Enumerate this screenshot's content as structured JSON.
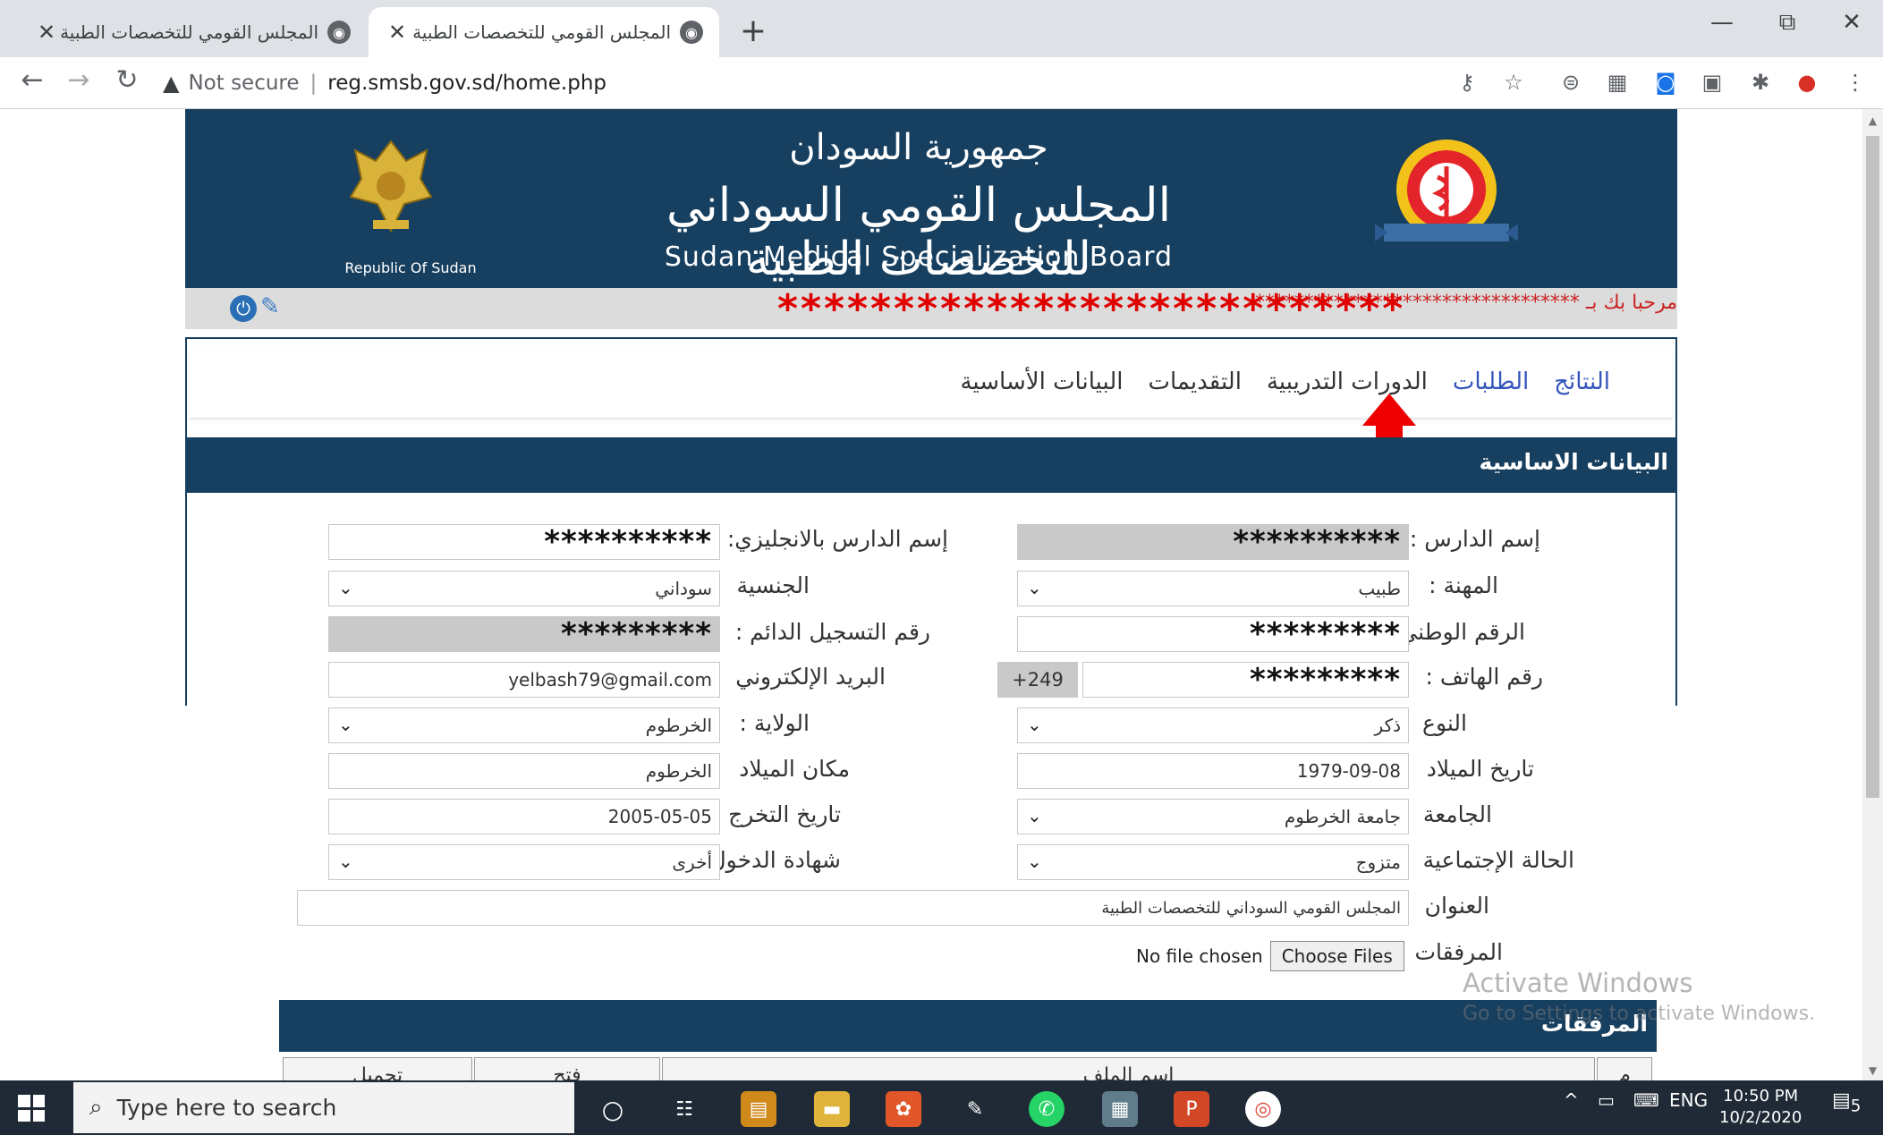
{
  "browser": {
    "tabs": [
      {
        "title": "المجلس القومي للتخصصات الطبية",
        "active": false
      },
      {
        "title": "المجلس القومي للتخصصات الطبية",
        "active": true
      }
    ],
    "new_tab": "+",
    "security": "Not secure",
    "url": "reg.smsb.gov.sd/home.php",
    "window_controls": {
      "minimize": "—",
      "restore": "⧉",
      "close": "✕"
    }
  },
  "banner": {
    "republic_label": "Republic Of Sudan",
    "arabic_line1": "جمهورية السودان",
    "arabic_line2": "المجلس القومي السوداني للتخصصات الطبية",
    "english_title": "Sudan Medical Specialization Board",
    "bg_color": "#173f5f"
  },
  "welcome": {
    "text": "مرحبا بك بـ *********************************",
    "stars": "***************************"
  },
  "menu": {
    "items": [
      {
        "label": "البيانات الأساسية",
        "style": "dark"
      },
      {
        "label": "التقديمات",
        "style": "dark"
      },
      {
        "label": "الدورات التدريبية",
        "style": "dark"
      },
      {
        "label": "الطلبات",
        "style": "blue"
      },
      {
        "label": "النتائج",
        "style": "blue"
      }
    ]
  },
  "section_title": "البيانات الاساسية",
  "form": {
    "student_name": {
      "label": "إسم الدارس :",
      "value": "**********"
    },
    "student_name_en": {
      "label": "إسم الدارس بالانجليزي:",
      "value": "**********"
    },
    "profession": {
      "label": "المهنة :",
      "value": "طبيب"
    },
    "nationality": {
      "label": "الجنسية",
      "value": "سوداني"
    },
    "national_id": {
      "label": "الرقم الوطني",
      "value": "*********"
    },
    "permanent_reg": {
      "label": "رقم التسجيل الدائم :",
      "value": "*********"
    },
    "phone": {
      "label": "رقم الهاتف :",
      "prefix": "+249",
      "value": "*********"
    },
    "email": {
      "label": "البريد الإلكتروني",
      "value": "yelbash79@gmail.com"
    },
    "gender": {
      "label": "النوع",
      "value": "ذكر"
    },
    "state": {
      "label": "الولاية :",
      "value": "الخرطوم"
    },
    "birth_date": {
      "label": "تاريخ الميلاد",
      "value": "1979-09-08"
    },
    "birth_place": {
      "label": "مكان الميلاد",
      "value": "الخرطوم"
    },
    "university": {
      "label": "الجامعة",
      "value": "جامعة الخرطوم"
    },
    "graduation_date": {
      "label": "تاريخ التخرج",
      "value": "2005-05-05"
    },
    "marital_status": {
      "label": "الحالة الإجتماعية",
      "value": "متزوج"
    },
    "entry_cert": {
      "label": "شهادة الدخول",
      "value": "أخرى"
    },
    "address": {
      "label": "العنوان",
      "value": "المجلس القومي السوداني للتخصصات الطبية"
    },
    "attachments": {
      "label": "المرفقات",
      "button": "Choose Files",
      "status": "No file chosen"
    }
  },
  "attachments_section": {
    "title": "المرفقات",
    "columns": [
      "م",
      "إسم الملف",
      "فتح",
      "تحميل"
    ]
  },
  "watermark": {
    "line1": "Activate Windows",
    "line2": "Go to Settings to activate Windows."
  },
  "taskbar": {
    "search_placeholder": "Type here to search",
    "language": "ENG",
    "time": "10:50 PM",
    "date": "10/2/2020",
    "notifications": "5"
  }
}
